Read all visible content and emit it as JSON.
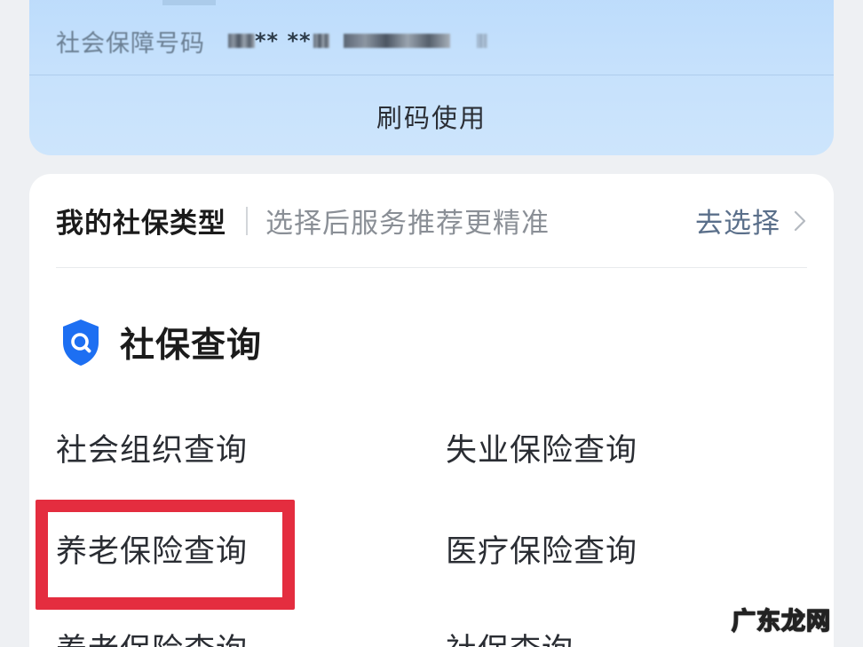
{
  "ss_card": {
    "number_label": "社会保障号码",
    "number_masked": "** **",
    "use_button": "刷码使用"
  },
  "type_row": {
    "title": "我的社保类型",
    "hint": "选择后服务推荐更精准",
    "action": "去选择"
  },
  "query_section": {
    "title": "社保查询",
    "items": [
      "社会组织查询",
      "失业保险查询",
      "养老保险查询",
      "医疗保险查询",
      "养老保险查询",
      "社保查询"
    ]
  },
  "watermark": "广东龙网",
  "colors": {
    "card_blue": "#c6e1fc",
    "shield_blue": "#1d6ff2",
    "highlight_red": "#e42d3f",
    "action_text": "#5a6f8a"
  }
}
